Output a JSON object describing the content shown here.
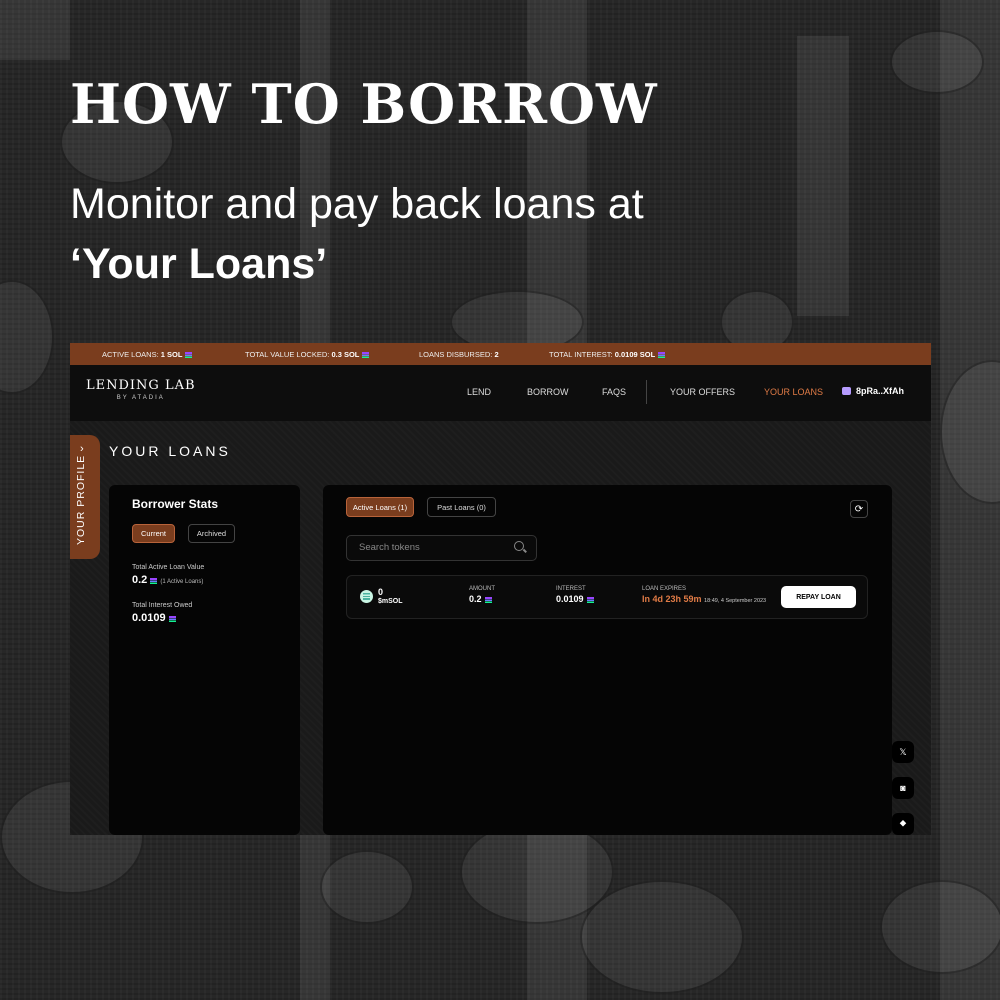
{
  "hero": {
    "title": "HOW TO BORROW",
    "subtitle_line1": "Monitor and pay back loans at",
    "subtitle_line2": "‘Your Loans’"
  },
  "stats_bar": {
    "active_loans_label": "ACTIVE LOANS:",
    "active_loans_value": "1 SOL",
    "tvl_label": "TOTAL VALUE LOCKED:",
    "tvl_value": "0.3 SOL",
    "disbursed_label": "LOANS DISBURSED:",
    "disbursed_value": "2",
    "interest_label": "TOTAL INTEREST:",
    "interest_value": "0.0109 SOL"
  },
  "brand": {
    "name": "LENDING LAB",
    "sub": "BY ATADIA"
  },
  "nav": {
    "lend": "LEND",
    "borrow": "BORROW",
    "faqs": "FAQS",
    "your_offers": "YOUR OFFERS",
    "your_loans": "YOUR LOANS",
    "wallet": "8pRa..XfAh"
  },
  "profile_tab": {
    "label": "YOUR PROFILE",
    "chevron": "›"
  },
  "page_title": "YOUR LOANS",
  "borrower_stats": {
    "title": "Borrower Stats",
    "tab_current": "Current",
    "tab_archived": "Archived",
    "active_value_label": "Total Active Loan Value",
    "active_value": "0.2",
    "active_count": "(1 Active Loans)",
    "interest_label": "Total Interest Owed",
    "interest_value": "0.0109"
  },
  "loans": {
    "tab_active": "Active Loans (1)",
    "tab_past": "Past Loans (0)",
    "search_placeholder": "Search tokens",
    "refresh_icon": "⟳",
    "rows": [
      {
        "token_amount": "0",
        "token_symbol": "$mSOL",
        "amount_label": "AMOUNT",
        "amount": "0.2",
        "interest_label": "INTEREST",
        "interest": "0.0109",
        "expires_label": "LOAN EXPIRES",
        "expires_in": "In 4d 23h 59m",
        "expires_at": "18:49, 4 September 2023",
        "action": "REPAY LOAN"
      }
    ]
  },
  "social": {
    "twitter": "𝕏",
    "discord": "◙",
    "other": "⯁"
  },
  "colors": {
    "accent": "#7a3d1e",
    "highlight": "#e07b46",
    "panel": "#050505"
  }
}
